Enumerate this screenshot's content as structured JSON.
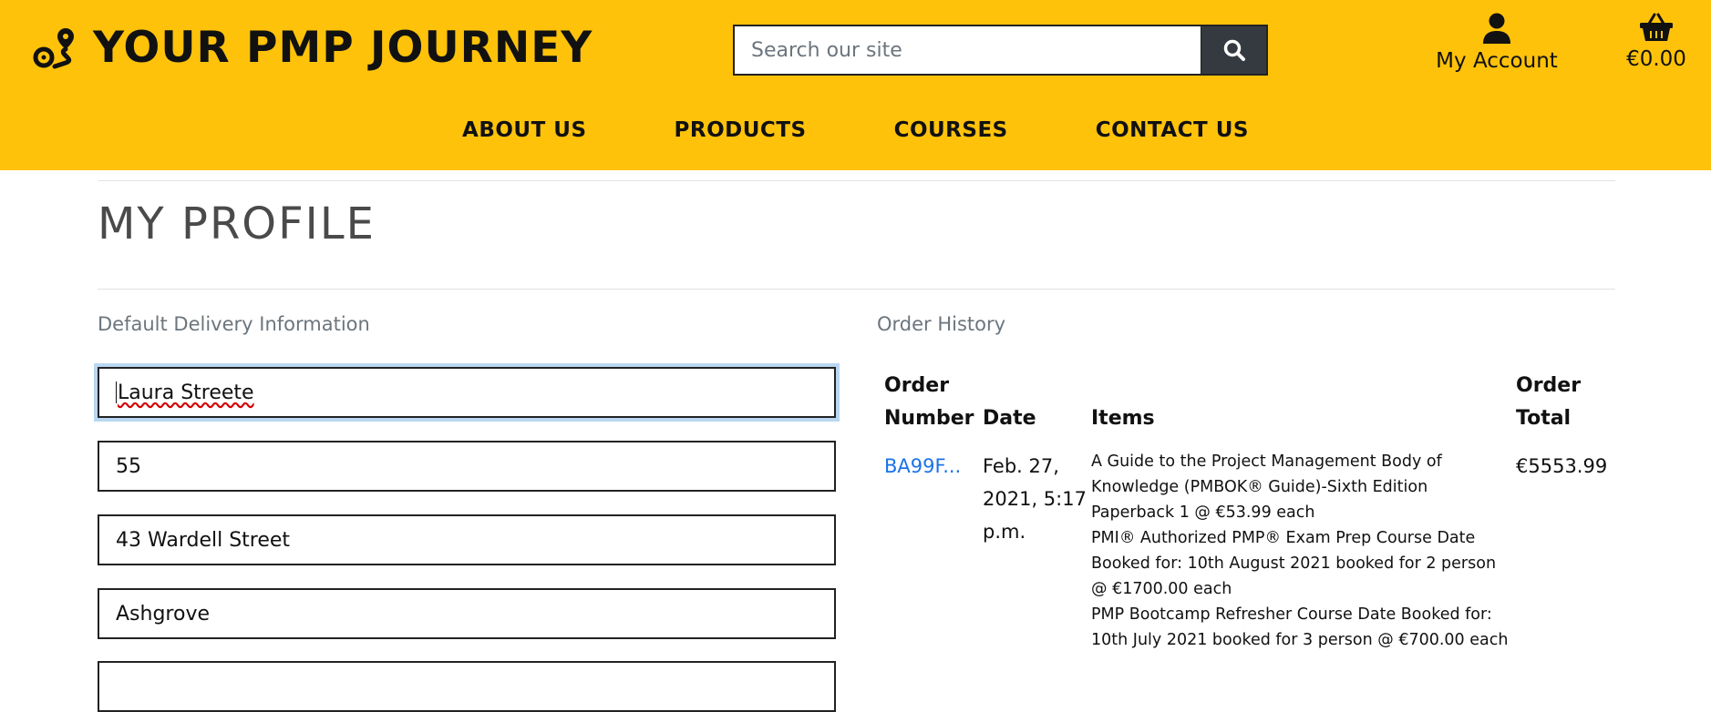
{
  "brand": {
    "name": "YOUR PMP JOURNEY",
    "icon": "route-icon"
  },
  "search": {
    "placeholder": "Search our site",
    "value": "",
    "button_icon": "search-icon"
  },
  "account": {
    "label": "My Account",
    "icon": "user-icon"
  },
  "cart": {
    "total": "€0.00",
    "icon": "basket-icon"
  },
  "nav": {
    "items": [
      {
        "label": "ABOUT US"
      },
      {
        "label": "PRODUCTS"
      },
      {
        "label": "COURSES"
      },
      {
        "label": "CONTACT US"
      }
    ]
  },
  "colors": {
    "header_bg": "#fec20a",
    "search_button_bg": "#343a40",
    "link": "#1a73e8",
    "focus_ring": "#b9d7f1"
  },
  "profile": {
    "title": "MY PROFILE",
    "delivery": {
      "heading": "Default Delivery Information",
      "fields": [
        {
          "value": "Laura Streete"
        },
        {
          "value": "55"
        },
        {
          "value": "43 Wardell Street"
        },
        {
          "value": "Ashgrove"
        }
      ]
    },
    "orders": {
      "heading": "Order History",
      "columns": {
        "number_line1": "Order",
        "number_line2": "Number",
        "date": "Date",
        "items": "Items",
        "total_line1": "Order",
        "total_line2": "Total"
      },
      "rows": [
        {
          "number": "BA99F...",
          "date_line1": "Feb. 27,",
          "date_line2": "2021, 5:17",
          "date_line3": "p.m.",
          "items": [
            "A Guide to the Project Management Body of",
            "Knowledge (PMBOK® Guide)-Sixth Edition",
            "Paperback 1 @ €53.99 each",
            "PMI® Authorized PMP® Exam Prep Course Date",
            "Booked for: 10th August 2021 booked for 2 person",
            "@ €1700.00 each",
            "PMP Bootcamp Refresher Course Date Booked for:",
            "10th July 2021 booked for 3 person @ €700.00 each"
          ],
          "total": "€5553.99"
        }
      ]
    }
  }
}
